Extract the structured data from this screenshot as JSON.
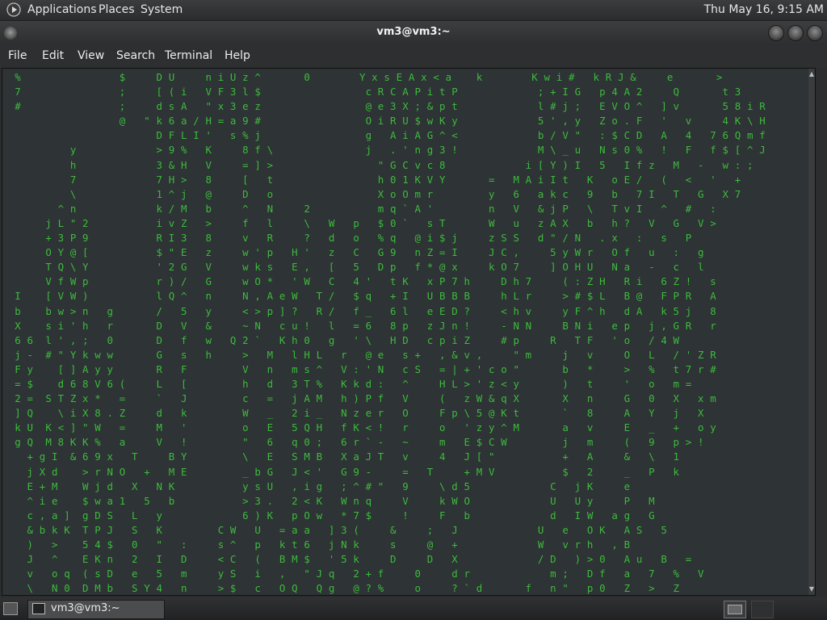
{
  "top_panel": {
    "applications": "Applications",
    "places": "Places",
    "system": "System",
    "clock": "Thu May 16,  9:15 AM"
  },
  "window": {
    "title": "vm3@vm3:~"
  },
  "menubar": {
    "file": "File",
    "edit": "Edit",
    "view": "View",
    "search": "Search",
    "terminal": "Terminal",
    "help": "Help"
  },
  "terminal": {
    "lines": [
      "  %                $     D U     n i U z ^       0        Y x s E A x < a    k        K w i #   k R J &     e       >",
      "  7                ;     [ ( i   V F 3 l $                 c R C A P i t P             ; + I G   p 4 A 2     Q       t 3",
      "  #                ;     d s A   \" x 3 e z                 @ e 3 X ; & p t             l # j ;   E V O ^   ] v       5 8 i R",
      "                   @   \" k 6 a / H = a 9 #                 O i R U $ w K y             5 ' , y   Z o . F   '   v     4 K \\ H",
      "                         D F L I '   s % j                 g   A i A G ^ <             b / V \"   : $ C D   A   4   7 6 Q m f",
      "           y             > 9 %   K     8 f \\               j   . ' n g 3 !             M \\ _ u   N s 0 %   !   F   f $ [ ^ J",
      "           h             3 & H   V     = ] >                 \" G C v c 8             i [ Y ) I   5   I f z   M   -   w : ;",
      "           7             7 H >   8     [   t                 h 0 1 K V Y       =   M A i I t   K   o E /   (   <   '   +",
      "           \\             1 ^ j   @     D   o                 X o O m r         y   6   a k c   9   b   7 I   T   G   X 7",
      "         ^ n             k / M   b     ^   N     2           m q ` A '         n   V   & j P   \\   T v I   ^   #   :",
      "       j L \" 2           i v Z   >     f   l     \\   W   p   $ 0 `   s T       W   u   z A X   b   h ?   V   G   V >",
      "       + 3 P 9           R I 3   8     v   R     ?   d   o   % q   @ i $ j     z S S   d \" / N   . x   :   s   P",
      "       O Y @ [           $ \" E   z     w ' p   H '   z   C   G 9   n Z = I     J C ,     5 y W r   O f   u   :   g",
      "       T Q \\ Y           ' 2 G   V     w k s   E ,   [   5   D p   f * @ x     k O 7     ] O H U   N a   -   c   l",
      "       V f W p           r ) /   G     w O *   ' W   C   4 '   t K   x P 7 h     D h 7     ( : Z H   R i   6 Z !   s",
      "  I    [ V W )           l Q ^   n     N , A e W   T /   $ q   + I   U B B B     h L r     > # $ L   B @   F P R   A",
      "  b    b w > n   g       /   5   y     < > p ] ?   R /   f _   6 l   e E D ?     < h v     y F ^ h   d A   k 5 j   8",
      "  X    s i ' h   r       D   V   &     ~ N   c u !   l   = 6   8 p   z J n !     - N N     B N i   e p   j , G R   r",
      "  6 6  l ' , ;   0       D   f   w   Q 2 `   K h 0   g   ' \\   H D   c p i Z     # p     R   T F   ' o   / 4 W",
      "  j -  # \" Y k w w       G   s   h     >   M   l H L   r   @ e   s +   , & v ,     \" m     j   v     O   L   / ' Z R",
      "  F y    [ ] A y y       R   F         V   n   m s ^   V : ' N   c S   = | + ' c o \"       b   *     >   %   t 7 r #",
      "  = $    d 6 8 V 6 (     L   [         h   d   3 T %   K k d :   ^     H L > ' z < y       )   t     '   o   m =",
      "  2 =  S T Z x *   =     `   J         c   =   j A M   h ) P f   V     (   z W & q X       X   n     G   0   X   x m",
      "  ] Q    \\ i X 8 . Z     d   k         W   _   2 i _   N z e r   O     F p \\ 5 @ K t       `   8     A   Y   j   X",
      "  k U  K < ] \" W   =     M   '         o   E   5 Q H   f K < !   r     o   ' z y ^ M       a   v     E   _   +   o y",
      "  g Q  M 8 K K %   a     V   !         \"   6   q 0 ;   6 r ` -   ~     m   E $ C W         j   m     (   9   p > !",
      "    + g I  & 6 9 x   T     B Y         \\   E   S M B   X a J T   v     4   J [ \"           +   A     &   \\   1",
      "    j X d    > r N O   +   M E         _ b G   J < '   G 9 -     =   T     + M V           $   2     _   P   k",
      "    E + M    W j d   X   N K           y s U   , i g   ; ^ # \"   9     \\ d 5             C   j K     e",
      "    ^ i e    $ w a 1   5   b           > 3 .   2 < K   W n q     V     k W O             U   U y     P   M",
      "    c , a ]  g D S   L   y             6 ) K   p O w   * 7 $     !     F   b             d   I W   a g   G",
      "    & b k K  T P J   S   K         C W   U   = a a   ] 3 (     &     ;   J             U   e   O K   A S   5",
      "    )   >    5 4 $   0   \"   :     s ^   p   k t 6   j N k     s     @   +             W   v r h   , B",
      "    J   ^    E K n   2   I   D     < C   (   B M $   ' 5 k     D     D   X             / D   ) > 0   A u   B   =",
      "    v   o q  ( s D   e   5   m     y S   i   ,   \" J q   2 + f     0     d r             m ;   D f   a   7   %   V",
      "    \\   N 0  D M b   S Y 4   n     > $   c   O Q   Q g   @ ? %     o     ? ` d       f   n \"   p 0   Z   >   Z"
    ]
  }
}
